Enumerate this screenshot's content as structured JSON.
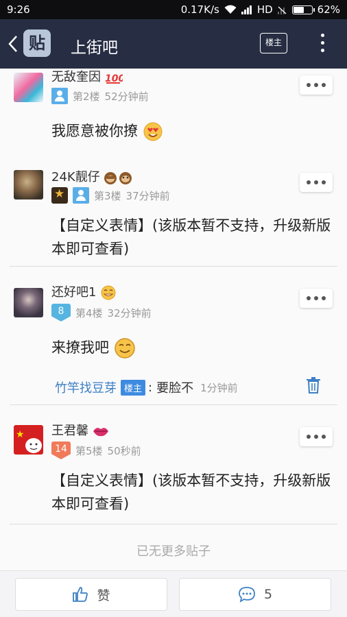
{
  "status_bar": {
    "time": "9:26",
    "speed": "0.17K/s",
    "network": "HD",
    "battery": "62%",
    "battery_level": 0.62
  },
  "header": {
    "logo": "贴",
    "title": "上街吧",
    "louzhu_label": "楼主"
  },
  "posts": [
    {
      "name": "无敌奎因",
      "emoji": "100-emoji",
      "floor": "第2楼",
      "time": "52分钟前",
      "text": "我愿意被你撩",
      "text_emoji": "heart-eyes-emoji"
    },
    {
      "name": "24K靓仔",
      "emoji": "see-no-evil-monkey-emoji",
      "floor": "第3楼",
      "time": "37分钟前",
      "text": "【自定义表情】(该版本暂不支持，升级新版本即可查看)"
    },
    {
      "name": "还好吧1",
      "emoji": "grin-emoji",
      "level": "8",
      "level_color": "#56b4e0",
      "floor": "第4楼",
      "time": "32分钟前",
      "text": "来撩我吧",
      "text_emoji": "smile-emoji"
    },
    {
      "name": "王君馨",
      "emoji": "lips-emoji",
      "level": "14",
      "level_color": "#f07a5a",
      "floor": "第5楼",
      "time": "50秒前",
      "text": "【自定义表情】(该版本暂不支持，升级新版本即可查看)"
    }
  ],
  "reply": {
    "user": "竹竿找豆芽",
    "tag": "楼主",
    "colon": ":",
    "text": "要脸不",
    "time": "1分钟前"
  },
  "no_more": "已无更多贴子",
  "bottom_bar": {
    "like_label": "赞",
    "comment_count": "5"
  },
  "colors": {
    "header_bg": "#272e43",
    "link_blue": "#3d7fc4",
    "badge_blue": "#3d8be0"
  }
}
